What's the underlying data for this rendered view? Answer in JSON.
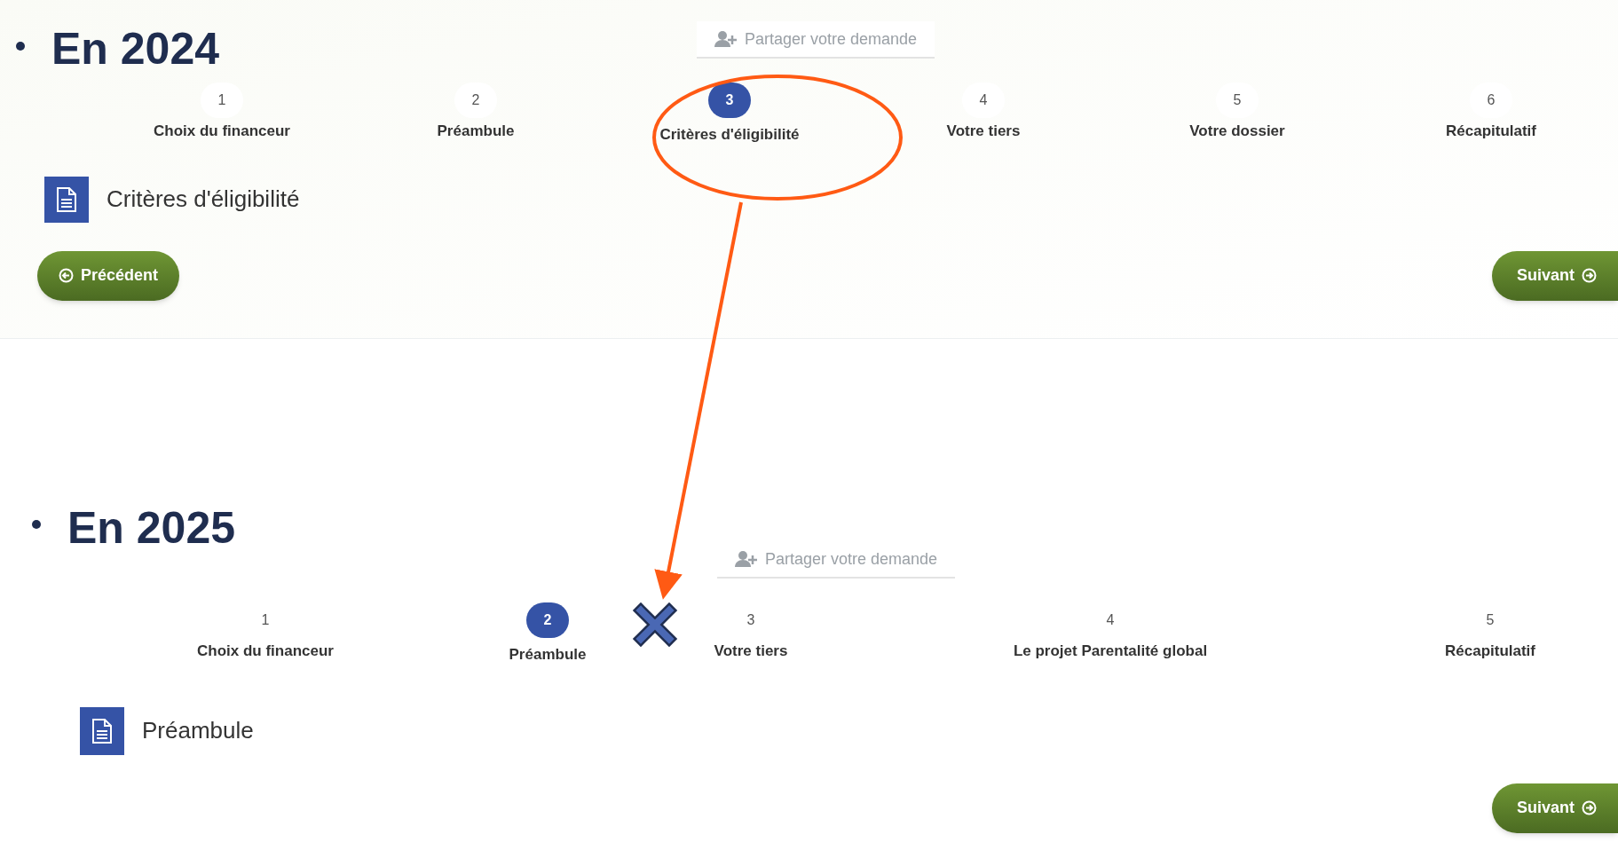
{
  "sections": [
    {
      "heading": "En 2024",
      "share_button": "Partager votre demande",
      "page_title": "Critères d'éligibilité",
      "steps": [
        {
          "number": "1",
          "label": "Choix du financeur",
          "selected": false
        },
        {
          "number": "2",
          "label": "Préambule",
          "selected": false
        },
        {
          "number": "3",
          "label": "Critères d'éligibilité",
          "selected": true
        },
        {
          "number": "4",
          "label": "Votre tiers",
          "selected": false
        },
        {
          "number": "5",
          "label": "Votre dossier",
          "selected": false
        },
        {
          "number": "6",
          "label": "Récapitulatif",
          "selected": false
        }
      ],
      "buttons": [
        {
          "label": "Précédent",
          "kind": "previous"
        },
        {
          "label": "Suivant",
          "kind": "next"
        }
      ]
    },
    {
      "heading": "En 2025",
      "share_button": "Partager votre demande",
      "page_title": "Préambule",
      "steps": [
        {
          "number": "1",
          "label": "Choix du financeur",
          "selected": false
        },
        {
          "number": "2",
          "label": "Préambule",
          "selected": true
        },
        {
          "number": "3",
          "label": "Votre tiers",
          "selected": false
        },
        {
          "number": "4",
          "label": "Le projet Parentalité global",
          "selected": false
        },
        {
          "number": "5",
          "label": "Récapitulatif",
          "selected": false
        }
      ],
      "buttons": [
        {
          "label": "Suivant",
          "kind": "next"
        }
      ]
    }
  ]
}
